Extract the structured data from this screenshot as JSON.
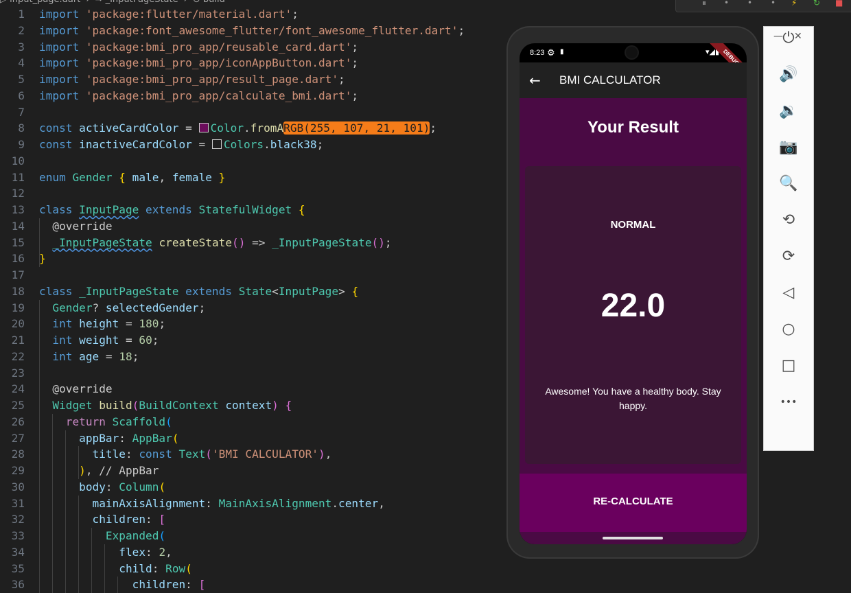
{
  "editor": {
    "breadcrumb": [
      "▷ input_page.dart",
      "›",
      "⇒ _InputPageState",
      "›",
      "⊙ build"
    ],
    "lines": [
      {
        "n": "1",
        "t": [
          [
            "k",
            "import "
          ],
          [
            "s",
            "'package:flutter/material.dart'"
          ],
          [
            "p",
            ";"
          ]
        ]
      },
      {
        "n": "2",
        "t": [
          [
            "k",
            "import "
          ],
          [
            "s",
            "'package:font_awesome_flutter/font_awesome_flutter.dart'"
          ],
          [
            "p",
            ";"
          ]
        ]
      },
      {
        "n": "3",
        "t": [
          [
            "k",
            "import "
          ],
          [
            "s",
            "'package:bmi_pro_app/reusable_card.dart'"
          ],
          [
            "p",
            ";"
          ]
        ]
      },
      {
        "n": "4",
        "t": [
          [
            "k",
            "import "
          ],
          [
            "s",
            "'package:bmi_pro_app/iconAppButton.dart'"
          ],
          [
            "p",
            ";"
          ]
        ]
      },
      {
        "n": "5",
        "t": [
          [
            "k",
            "import "
          ],
          [
            "s",
            "'package:bmi_pro_app/result_page.dart'"
          ],
          [
            "p",
            ";"
          ]
        ]
      },
      {
        "n": "6",
        "t": [
          [
            "k",
            "import "
          ],
          [
            "s",
            "'package:bmi_pro_app/calculate_bmi.dart'"
          ],
          [
            "p",
            ";"
          ]
        ]
      },
      {
        "n": "7",
        "t": []
      },
      {
        "n": "8",
        "t": [
          [
            "k",
            "const "
          ],
          [
            "v",
            "activeCardColor"
          ],
          [
            "p",
            " = "
          ],
          [
            "sw1",
            ""
          ],
          [
            "t",
            "Color"
          ],
          [
            "p",
            "."
          ],
          [
            "f",
            "fromA"
          ],
          [
            "hl",
            "RGB(255, 107, 21, 101)"
          ],
          [
            "p",
            ";"
          ]
        ]
      },
      {
        "n": "9",
        "t": [
          [
            "k",
            "const "
          ],
          [
            "v",
            "inactiveCardColor"
          ],
          [
            "p",
            " = "
          ],
          [
            "sw2",
            ""
          ],
          [
            "t",
            "Colors"
          ],
          [
            "p",
            "."
          ],
          [
            "v",
            "black38"
          ],
          [
            "p",
            ";"
          ]
        ]
      },
      {
        "n": "10",
        "t": []
      },
      {
        "n": "11",
        "t": [
          [
            "k",
            "enum "
          ],
          [
            "t",
            "Gender "
          ],
          [
            "b1",
            "{ "
          ],
          [
            "v",
            "male"
          ],
          [
            "p",
            ", "
          ],
          [
            "v",
            "female"
          ],
          [
            "b1",
            " }"
          ]
        ]
      },
      {
        "n": "12",
        "t": []
      },
      {
        "n": "13",
        "t": [
          [
            "k",
            "class "
          ],
          [
            "tsq",
            "InputPage"
          ],
          [
            "k",
            " extends "
          ],
          [
            "t",
            "StatefulWidget "
          ],
          [
            "b1",
            "{"
          ]
        ]
      },
      {
        "n": "14",
        "t": [
          [
            "p",
            "  @override"
          ]
        ]
      },
      {
        "n": "15",
        "t": [
          [
            "p",
            "  "
          ],
          [
            "tsq",
            "_InputPageState"
          ],
          [
            "p",
            " "
          ],
          [
            "f",
            "createState"
          ],
          [
            "b2",
            "()"
          ],
          [
            "p",
            " => "
          ],
          [
            "t",
            "_InputPageState"
          ],
          [
            "b2",
            "()"
          ],
          [
            "p",
            ";"
          ]
        ]
      },
      {
        "n": "16",
        "t": [
          [
            "b1",
            "}"
          ]
        ]
      },
      {
        "n": "17",
        "t": []
      },
      {
        "n": "18",
        "t": [
          [
            "k",
            "class "
          ],
          [
            "t",
            "_InputPageState"
          ],
          [
            "k",
            " extends "
          ],
          [
            "t",
            "State"
          ],
          [
            "p",
            "<"
          ],
          [
            "t",
            "InputPage"
          ],
          [
            "p",
            "> "
          ],
          [
            "b1",
            "{"
          ]
        ]
      },
      {
        "n": "19",
        "t": [
          [
            "p",
            "  "
          ],
          [
            "t",
            "Gender"
          ],
          [
            "p",
            "? "
          ],
          [
            "v",
            "selectedGender"
          ],
          [
            "p",
            ";"
          ]
        ]
      },
      {
        "n": "20",
        "t": [
          [
            "p",
            "  "
          ],
          [
            "k",
            "int "
          ],
          [
            "v",
            "height"
          ],
          [
            "p",
            " = "
          ],
          [
            "n",
            "180"
          ],
          [
            "p",
            ";"
          ]
        ]
      },
      {
        "n": "21",
        "t": [
          [
            "p",
            "  "
          ],
          [
            "k",
            "int "
          ],
          [
            "v",
            "weight"
          ],
          [
            "p",
            " = "
          ],
          [
            "n",
            "60"
          ],
          [
            "p",
            ";"
          ]
        ]
      },
      {
        "n": "22",
        "t": [
          [
            "p",
            "  "
          ],
          [
            "k",
            "int "
          ],
          [
            "v",
            "age"
          ],
          [
            "p",
            " = "
          ],
          [
            "n",
            "18"
          ],
          [
            "p",
            ";"
          ]
        ]
      },
      {
        "n": "23",
        "t": []
      },
      {
        "n": "24",
        "t": [
          [
            "p",
            "  @override"
          ]
        ]
      },
      {
        "n": "25",
        "t": [
          [
            "p",
            "  "
          ],
          [
            "t",
            "Widget "
          ],
          [
            "f",
            "build"
          ],
          [
            "b2",
            "("
          ],
          [
            "t",
            "BuildContext "
          ],
          [
            "v",
            "context"
          ],
          [
            "b2",
            ") "
          ],
          [
            "b2",
            "{"
          ]
        ]
      },
      {
        "n": "26",
        "t": [
          [
            "p",
            "    "
          ],
          [
            "kc",
            "return "
          ],
          [
            "t",
            "Scaffold"
          ],
          [
            "b3",
            "("
          ]
        ]
      },
      {
        "n": "27",
        "t": [
          [
            "p",
            "      "
          ],
          [
            "v",
            "appBar"
          ],
          [
            "p",
            ": "
          ],
          [
            "t",
            "AppBar"
          ],
          [
            "b1",
            "("
          ]
        ]
      },
      {
        "n": "28",
        "t": [
          [
            "p",
            "        "
          ],
          [
            "v",
            "title"
          ],
          [
            "p",
            ": "
          ],
          [
            "k",
            "const "
          ],
          [
            "t",
            "Text"
          ],
          [
            "b2",
            "("
          ],
          [
            "s",
            "'BMI CALCULATOR'"
          ],
          [
            "b2",
            ")"
          ],
          [
            "p",
            ","
          ]
        ]
      },
      {
        "n": "29",
        "t": [
          [
            "p",
            "      "
          ],
          [
            "b1",
            ")"
          ],
          [
            "p",
            ", // AppBar"
          ]
        ]
      },
      {
        "n": "30",
        "t": [
          [
            "p",
            "      "
          ],
          [
            "v",
            "body"
          ],
          [
            "p",
            ": "
          ],
          [
            "t",
            "Column"
          ],
          [
            "b1",
            "("
          ]
        ]
      },
      {
        "n": "31",
        "t": [
          [
            "p",
            "        "
          ],
          [
            "v",
            "mainAxisAlignment"
          ],
          [
            "p",
            ": "
          ],
          [
            "t",
            "MainAxisAlignment"
          ],
          [
            "p",
            "."
          ],
          [
            "v",
            "center"
          ],
          [
            "p",
            ","
          ]
        ]
      },
      {
        "n": "32",
        "t": [
          [
            "p",
            "        "
          ],
          [
            "v",
            "children"
          ],
          [
            "p",
            ": "
          ],
          [
            "b2",
            "["
          ]
        ]
      },
      {
        "n": "33",
        "t": [
          [
            "p",
            "          "
          ],
          [
            "t",
            "Expanded"
          ],
          [
            "b3",
            "("
          ]
        ]
      },
      {
        "n": "34",
        "t": [
          [
            "p",
            "            "
          ],
          [
            "v",
            "flex"
          ],
          [
            "p",
            ": "
          ],
          [
            "n",
            "2"
          ],
          [
            "p",
            ","
          ]
        ]
      },
      {
        "n": "35",
        "t": [
          [
            "p",
            "            "
          ],
          [
            "v",
            "child"
          ],
          [
            "p",
            ": "
          ],
          [
            "t",
            "Row"
          ],
          [
            "b1",
            "("
          ]
        ]
      },
      {
        "n": "36",
        "t": [
          [
            "p",
            "              "
          ],
          [
            "v",
            "children"
          ],
          [
            "p",
            ": "
          ],
          [
            "b2",
            "["
          ]
        ]
      }
    ]
  },
  "colors": {
    "active_swatch": "#6b0c5b",
    "inactive_swatch": "#1f1f1f",
    "highlight": "#f57c19"
  },
  "emulator": {
    "status_time": "8:23",
    "debug_banner": "DEBUG",
    "app_title": "BMI CALCULATOR",
    "result_title": "Your Result",
    "result_status": "NORMAL",
    "bmi_value": "22.0",
    "bmi_message": "Awesome! You have a healthy body. Stay happy.",
    "recalculate_label": "RE-CALCULATE"
  },
  "emulator_panel": {
    "minimize": "—",
    "close": "✕",
    "buttons": [
      {
        "name": "power-icon",
        "glyph": "⏻"
      },
      {
        "name": "volume-up-icon",
        "glyph": "🔊"
      },
      {
        "name": "volume-down-icon",
        "glyph": "🔉"
      },
      {
        "name": "camera-icon",
        "glyph": "📷"
      },
      {
        "name": "zoom-icon",
        "glyph": "🔍"
      },
      {
        "name": "rotate-left-icon",
        "glyph": "⟲"
      },
      {
        "name": "rotate-right-icon",
        "glyph": "⟳"
      },
      {
        "name": "back-icon",
        "glyph": "◁"
      },
      {
        "name": "home-icon",
        "glyph": "○"
      },
      {
        "name": "overview-icon",
        "glyph": "□"
      },
      {
        "name": "more-icon",
        "glyph": "•••"
      }
    ]
  }
}
